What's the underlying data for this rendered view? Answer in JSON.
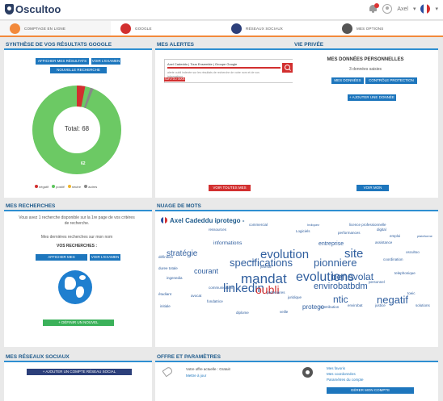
{
  "app": {
    "title": "Oscultoo"
  },
  "topbar": {
    "user_label": "Axel"
  },
  "tabs": [
    {
      "label": "Comptage en ligne",
      "color": "#f2893b"
    },
    {
      "label": "Google",
      "color": "#d22f2f"
    },
    {
      "label": "Réseaux sociaux",
      "color": "#2c3f7a"
    },
    {
      "label": "Mes options",
      "color": "#555555"
    }
  ],
  "google": {
    "title": "Synthèse de vos résultats Google",
    "btn_refresh": "Afficher mes résultats",
    "btn_examine": "Voir l'examen",
    "btn_new_search": "Nouvelle recherche",
    "total_label": "Total: 68",
    "segment_label": "62",
    "legend": [
      {
        "label": "négatif",
        "color": "#d22f2f"
      },
      {
        "label": "positif",
        "color": "#5cc45c"
      },
      {
        "label": "neutre",
        "color": "#f0b429"
      },
      {
        "label": "autres",
        "color": "#888888"
      }
    ]
  },
  "alerts": {
    "title": "Mes alertes",
    "card_line1": "Axel Cadeddu | Tous Ensemble | Groupe Google",
    "card_line2": "alerte oubli indexée sur les résultats de recherche de votre nom et de vos informations",
    "card_tag": "Suivi du 04/08",
    "btn_all": "Voir toutes mes alertes"
  },
  "privacy": {
    "title": "Vie privée",
    "heading": "Mes données personnelles",
    "subheading": "3 données saisies",
    "btn_my_data": "Mes données",
    "btn_protect": "Contrôle protection",
    "btn_add": "+ Ajouter une donnée",
    "btn_profile": "Voir mon profil"
  },
  "searches": {
    "title": "Mes recherches",
    "text1": "Vous avez 1 recherche disponible sur la 1re page de vos critères de recherche.",
    "text2": "Mes dernières recherches sur mon nom",
    "heading": "Vos recherches :",
    "btn_view": "Afficher mes recherches",
    "btn_examine": "Voir l'examen",
    "btn_international": "+ Définir un nouvel internationale"
  },
  "wordcloud": {
    "title": "Nuage de mots",
    "subject": "Axel Cadeddu iprotego -",
    "words": [
      "commercial",
      "Indiquez",
      "licence professionnelle",
      "ressources",
      "Logiciels",
      "digital",
      "performances",
      "emploi",
      "plateforme",
      "informations",
      "entreprise",
      "assistance",
      "stratégie",
      "evolution",
      "site",
      "oscultoo",
      "outil",
      "définition",
      "specifications",
      "pionniere",
      "coordination",
      "courant",
      "journal",
      "mandat",
      "evolutions",
      "benevolat",
      "telephonique",
      "duree totale",
      "ingenedia",
      "linkedin",
      "oubli",
      "envirobatbdm",
      "personnel",
      "ntic",
      "negatif",
      "envirobat",
      "toeic",
      "protego",
      "contribution",
      "justice",
      "initiale",
      "fondatrice",
      "veille",
      "diplome",
      "communication",
      "avocat",
      "étudiant",
      "partenaires",
      "solutions",
      "juridique"
    ]
  },
  "social": {
    "title": "Mes réseaux sociaux",
    "btn_add": "+ Ajouter un compte réseau social"
  },
  "offer": {
    "title": "Offre et paramètres",
    "plan_line1": "Votre offre actuelle : Gratuit",
    "plan_line2": "Mettre à jour",
    "settings_line1": "Mes favoris",
    "settings_line2": "Mes coordonnées",
    "settings_line3": "Paramètres du compte",
    "btn_account": "Gérer mon compte"
  }
}
